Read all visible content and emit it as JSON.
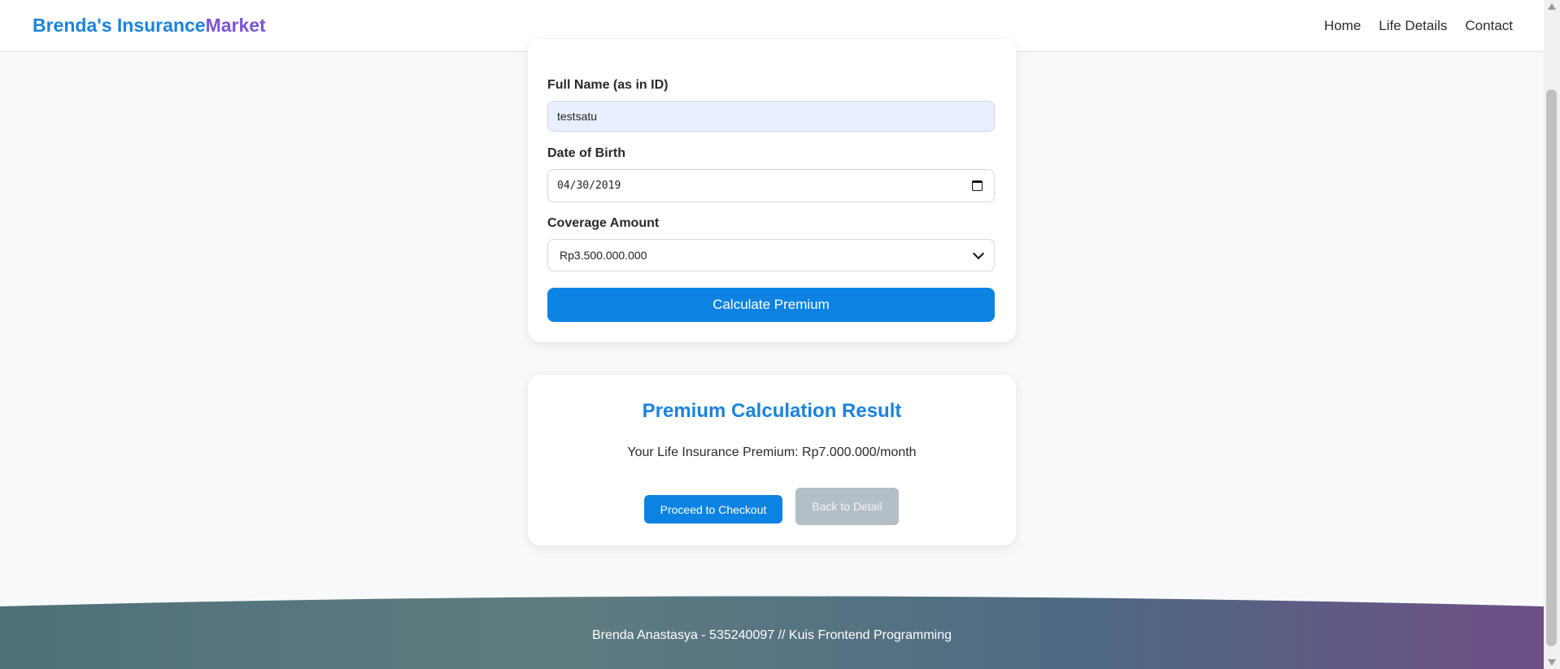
{
  "header": {
    "brand_part1": "Brenda's Insurance",
    "brand_part2": "Market",
    "nav": [
      "Home",
      "Life Details",
      "Contact"
    ]
  },
  "form": {
    "name_label": "Full Name (as in ID)",
    "name_value": "testsatu",
    "dob_label": "Date of Birth",
    "dob_value": "04/30/2019",
    "coverage_label": "Coverage Amount",
    "coverage_value": "Rp3.500.000.000",
    "calculate_label": "Calculate Premium"
  },
  "result": {
    "title": "Premium Calculation Result",
    "text": "Your Life Insurance Premium: Rp7.000.000/month",
    "checkout_label": "Proceed to Checkout",
    "back_label": "Back to Detail"
  },
  "footer": {
    "text": "Brenda Anastasya - 535240097 // Kuis Frontend Programming"
  },
  "colors": {
    "accent": "#0c83e2",
    "brand_blue": "#1a83dd",
    "brand_purple": "#7a55d8",
    "footer_start": "#4f6f78",
    "footer_end": "#6e4f86"
  }
}
